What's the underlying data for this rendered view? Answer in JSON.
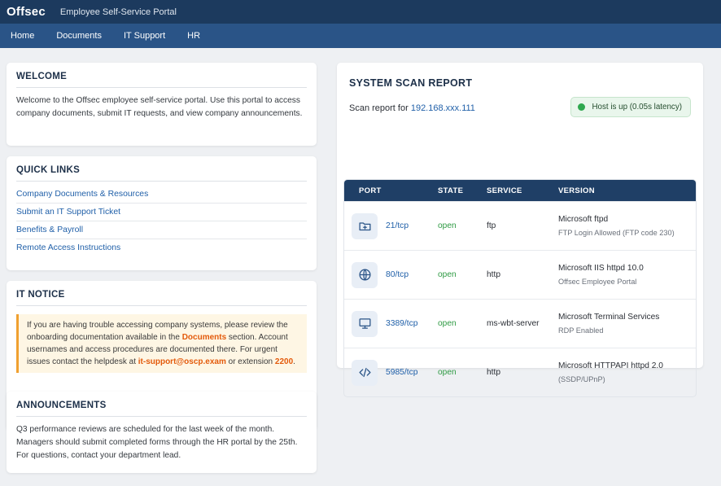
{
  "header": {
    "brand": "Offsec",
    "portal_title": "Employee Self-Service Portal"
  },
  "nav": {
    "items": [
      "Home",
      "Documents",
      "IT Support",
      "HR"
    ]
  },
  "welcome": {
    "title": "WELCOME",
    "text": "Welcome to the Offsec employee self-service portal. Use this portal to access company documents, submit IT requests, and view company announcements."
  },
  "quick_links": {
    "title": "QUICK LINKS",
    "items": [
      "Company Documents & Resources",
      "Submit an IT Support Ticket",
      "Benefits & Payroll",
      "Remote Access Instructions"
    ]
  },
  "it_notice": {
    "title": "IT NOTICE",
    "part1": "If you are having trouble accessing company systems, please review the onboarding documentation available in the ",
    "link_documents": "Documents",
    "part2": " section. Account usernames and access procedures are documented there. For urgent issues contact the helpdesk at ",
    "email": "it-support@oscp.exam",
    "part3": " or extension ",
    "extension": "2200",
    "part4": "."
  },
  "announcements": {
    "title": "ANNOUNCEMENTS",
    "text": "Q3 performance reviews are scheduled for the last week of the month. Managers should submit completed forms through the HR portal by the 25th. For questions, contact your department lead."
  },
  "scan": {
    "title": "SYSTEM SCAN REPORT",
    "prefix": "Scan report for ",
    "ip": "192.168.xxx.111",
    "host_status": "Host is up (0.05s latency)",
    "host_status_color": "#2fa84f",
    "columns": {
      "port": "PORT",
      "state": "STATE",
      "service": "SERVICE",
      "version": "VERSION"
    },
    "rows": [
      {
        "icon": "folder-plus-icon",
        "port": "21/tcp",
        "state": "open",
        "service": "ftp",
        "version": "Microsoft ftpd",
        "detail": "FTP Login Allowed (FTP code 230)"
      },
      {
        "icon": "globe-icon",
        "port": "80/tcp",
        "state": "open",
        "service": "http",
        "version": "Microsoft IIS httpd 10.0",
        "detail": "Offsec Employee Portal"
      },
      {
        "icon": "monitor-icon",
        "port": "3389/tcp",
        "state": "open",
        "service": "ms-wbt-server",
        "version": "Microsoft Terminal Services",
        "detail": "RDP Enabled"
      },
      {
        "icon": "code-icon",
        "port": "5985/tcp",
        "state": "open",
        "service": "http",
        "version": "Microsoft HTTPAPI httpd 2.0",
        "detail": "(SSDP/UPnP)"
      }
    ]
  }
}
